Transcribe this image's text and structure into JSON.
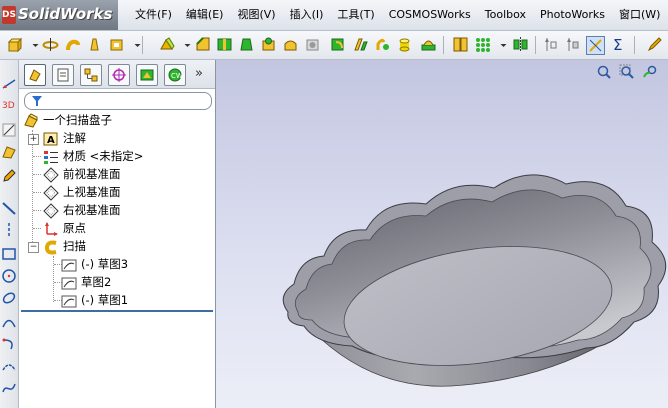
{
  "app": {
    "logo_mark": "DS",
    "brand": "SolidWorks"
  },
  "menu": {
    "items": [
      "文件(F)",
      "编辑(E)",
      "视图(V)",
      "插入(I)",
      "工具(T)",
      "COSMOSWorks",
      "Toolbox",
      "PhotoWorks",
      "窗口(W)"
    ]
  },
  "toolbar": {
    "icons": [
      "extrude-boss-icon",
      "revolve-icon",
      "sweep-icon",
      "loft-icon",
      "shell-icon",
      "fillet-icon",
      "chamfer-icon",
      "rib-icon",
      "draft-icon",
      "wrap-icon",
      "dome-icon",
      "hole-wizard-icon",
      "linear-pattern-icon",
      "mirror-icon",
      "reference-geometry-icon",
      "curves-icon",
      "sum-icon"
    ]
  },
  "panel": {
    "tabs": [
      "feature-manager-tab",
      "property-manager-tab",
      "configuration-manager-tab",
      "dimxpert-tab",
      "display-manager-tab",
      "cosmos-tab"
    ],
    "more_label": "»"
  },
  "tree": {
    "root": "一个扫描盘子",
    "items": [
      {
        "label": "注解",
        "icon": "annotations-icon",
        "expandable": true,
        "expand_label": "+"
      },
      {
        "label": "材质 <未指定>",
        "icon": "material-icon",
        "expandable": false
      },
      {
        "label": "前视基准面",
        "icon": "plane-icon",
        "expandable": false
      },
      {
        "label": "上视基准面",
        "icon": "plane-icon",
        "expandable": false
      },
      {
        "label": "右视基准面",
        "icon": "plane-icon",
        "expandable": false
      },
      {
        "label": "原点",
        "icon": "origin-icon",
        "expandable": false
      },
      {
        "label": "扫描",
        "icon": "sweep-feature-icon",
        "expandable": true,
        "expand_label": "−"
      }
    ],
    "children": [
      {
        "label": "(-) 草图3",
        "icon": "sketch-icon"
      },
      {
        "label": "草图2",
        "icon": "sketch-icon"
      },
      {
        "label": "(-) 草图1",
        "icon": "sketch-icon"
      }
    ]
  },
  "colors": {
    "viewport_top": "#c3c6e0",
    "viewport_bottom": "#eceef7",
    "accent": "#3a6ea5"
  }
}
